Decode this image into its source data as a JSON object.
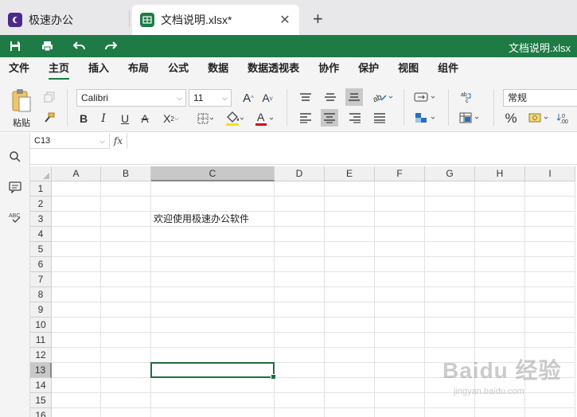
{
  "tabs": [
    {
      "title": "极速办公",
      "active": false
    },
    {
      "title": "文档说明.xlsx*",
      "active": true
    }
  ],
  "window": {
    "doc_name": "文档说明.xlsx"
  },
  "menu": [
    "文件",
    "主页",
    "插入",
    "布局",
    "公式",
    "数据",
    "数据透视表",
    "协作",
    "保护",
    "视图",
    "组件"
  ],
  "menu_active": "主页",
  "ribbon": {
    "paste_label": "粘贴",
    "font_name": "Calibri",
    "font_size": "11",
    "number_format": "常规",
    "percent_label": "%"
  },
  "formula_bar": {
    "cell_ref": "C13",
    "fx": "fx",
    "content": ""
  },
  "sheet": {
    "columns": [
      "A",
      "B",
      "C",
      "D",
      "E",
      "F",
      "G",
      "H",
      "I"
    ],
    "rows": [
      "1",
      "2",
      "3",
      "4",
      "5",
      "6",
      "7",
      "8",
      "9",
      "10",
      "11",
      "12",
      "13",
      "14",
      "15",
      "16"
    ],
    "selected_column": "C",
    "selected_row": "13",
    "cells": {
      "C3": "欢迎使用极速办公软件"
    }
  },
  "watermark": {
    "brand": "Baidu 经验",
    "url": "jingyan.baidu.com"
  },
  "colors": {
    "accent": "#1e7b46",
    "home_icon": "#4b2a8a",
    "font_color_bar": "#d0121b",
    "fill_color_bar": "#f5e400"
  }
}
